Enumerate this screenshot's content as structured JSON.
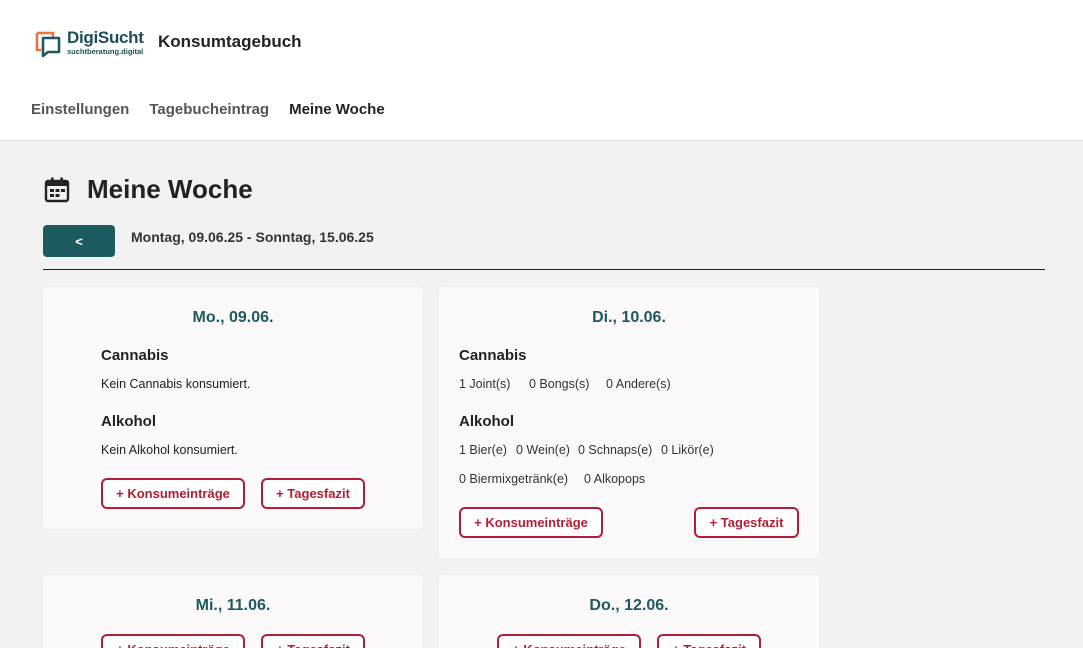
{
  "brand": {
    "name": "DigiSucht",
    "sub": "suchtberatung.digital",
    "colors": {
      "primary": "#1d5a5f",
      "accent": "#b21e35",
      "logo_orange": "#e8763a"
    }
  },
  "app_title": "Konsumtagebuch",
  "nav": [
    {
      "label": "Einstellungen"
    },
    {
      "label": "Tagebucheintrag"
    },
    {
      "label": "Meine Woche"
    }
  ],
  "page": {
    "title": "Meine Woche",
    "prev_label": "<",
    "range": "Montag, 09.06.25 - Sonntag, 15.06.25"
  },
  "labels": {
    "cannabis": "Cannabis",
    "alkohol": "Alkohol",
    "add_entries": "+ Konsumeinträge",
    "add_summary": "+ Tagesfazit"
  },
  "days": [
    {
      "date": "Mo., 09.06.",
      "cannabis_text": "Kein Cannabis konsumiert.",
      "alkohol_text": "Kein Alkohol konsumiert."
    },
    {
      "date": "Di., 10.06.",
      "cannabis": [
        "1 Joint(s)",
        "0 Bongs(s)",
        "0 Andere(s)"
      ],
      "alkohol": [
        "1 Bier(e)",
        "0 Wein(e)",
        "0 Schnaps(e)",
        "0 Likör(e)",
        "0 Biermixgetränk(e)",
        "0 Alkopops"
      ]
    },
    {
      "date": "Mi., 11.06."
    },
    {
      "date": "Do., 12.06."
    }
  ]
}
